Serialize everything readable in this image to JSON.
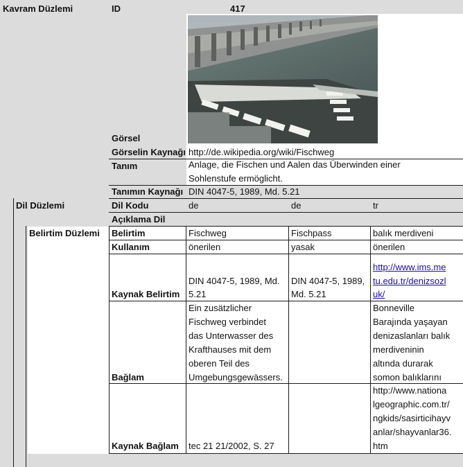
{
  "kavram": {
    "section": "Kavram Düzlemi",
    "id_label": "ID",
    "id_value": "417",
    "gorsel_label": "Görsel",
    "kaynak_label": "Görselin Kaynağı",
    "kaynak_value": "http://de.wikipedia.org/wiki/Fischweg",
    "tanim_label": "Tanım",
    "tanim_line1": "Anlage, die Fischen und Aalen das Überwinden einer",
    "tanim_line2": "Sohlenstufe ermöglicht.",
    "tanim_kaynak_label": "Tanımın Kaynağı",
    "tanim_kaynak_value": "DIN 4047-5, 1989, Md. 5.21"
  },
  "dil": {
    "section": "Dil Düzlemi",
    "kod_label": "Dil Kodu",
    "kodlar": [
      "de",
      "de",
      "tr"
    ],
    "aciklama_label": "Açıklama Dil"
  },
  "belirtim": {
    "section": "Belirtim Düzlemi",
    "belirtim_label": "Belirtim",
    "belirtimler": [
      "Fischweg",
      "Fischpass",
      "balık merdiveni"
    ],
    "kullanim_label": "Kullanım",
    "kullanimlar": [
      "önerilen",
      "yasak",
      "önerilen"
    ],
    "kaynak_belirtim_label": "Kaynak Belirtim",
    "kb_col1": [
      "DIN 4047-5, 1989, Md.",
      "5.21"
    ],
    "kb_col2": [
      "DIN 4047-5, 1989,",
      "Md. 5.21"
    ],
    "kb_col3": [
      "http://www.ims.me",
      "tu.edu.tr/denizsozl",
      "uk/"
    ],
    "baglam_label": "Bağlam",
    "baglam_col1": [
      "Ein zusätzlicher",
      "Fischweg verbindet",
      "das Unterwasser des",
      "Krafthauses mit dem",
      "oberen Teil des",
      "Umgebungsgewässers."
    ],
    "baglam_col3": [
      "Bonneville",
      "Barajında yaşayan",
      "denizaslanları balık",
      "merdiveninin",
      "altında durarak",
      "somon balıklarını"
    ],
    "kaynak_baglam_label": "Kaynak Bağlam",
    "kbag_col1": "tec 21 21/2002, S. 27",
    "kbag_col3": [
      "http://www.nationa",
      "lgeographic.com.tr/",
      "ngkids/sasirticihayv",
      "anlar/shayvanlar36.",
      "htm"
    ]
  }
}
